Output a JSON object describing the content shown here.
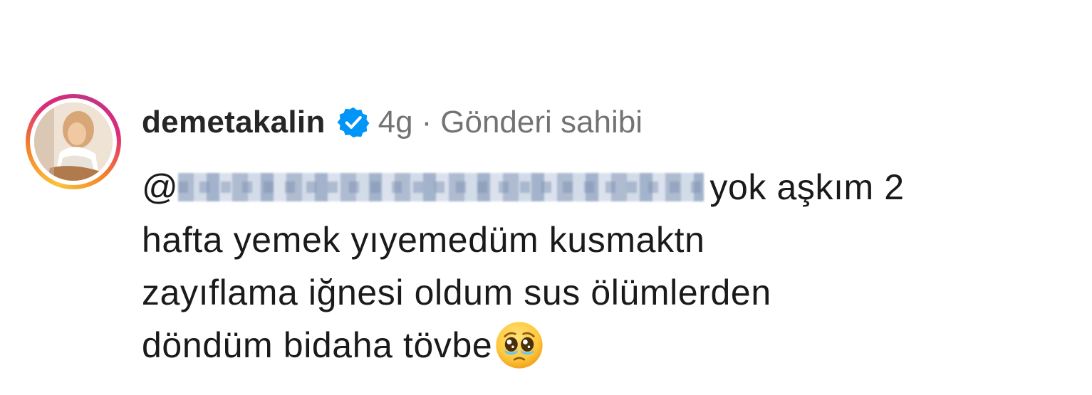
{
  "comment": {
    "username": "demetakalin",
    "verified": true,
    "time": "4g",
    "separator": "·",
    "role_label": "Gönderi sahibi",
    "mention_prefix": "@",
    "text_line1_after_mention": "yok aşkım 2",
    "text_line2": "hafta yemek yıyemedüm kusmaktn",
    "text_line3": "zayıflama iğnesi oldum sus ölümlerden",
    "text_line4": "döndüm bidaha tövbe",
    "emoji": "pleading-face-with-tears"
  },
  "colors": {
    "username": "#262626",
    "meta": "#737373",
    "verified_badge": "#0095f6",
    "story_ring_start": "#f9c33c",
    "story_ring_end": "#c13584"
  }
}
